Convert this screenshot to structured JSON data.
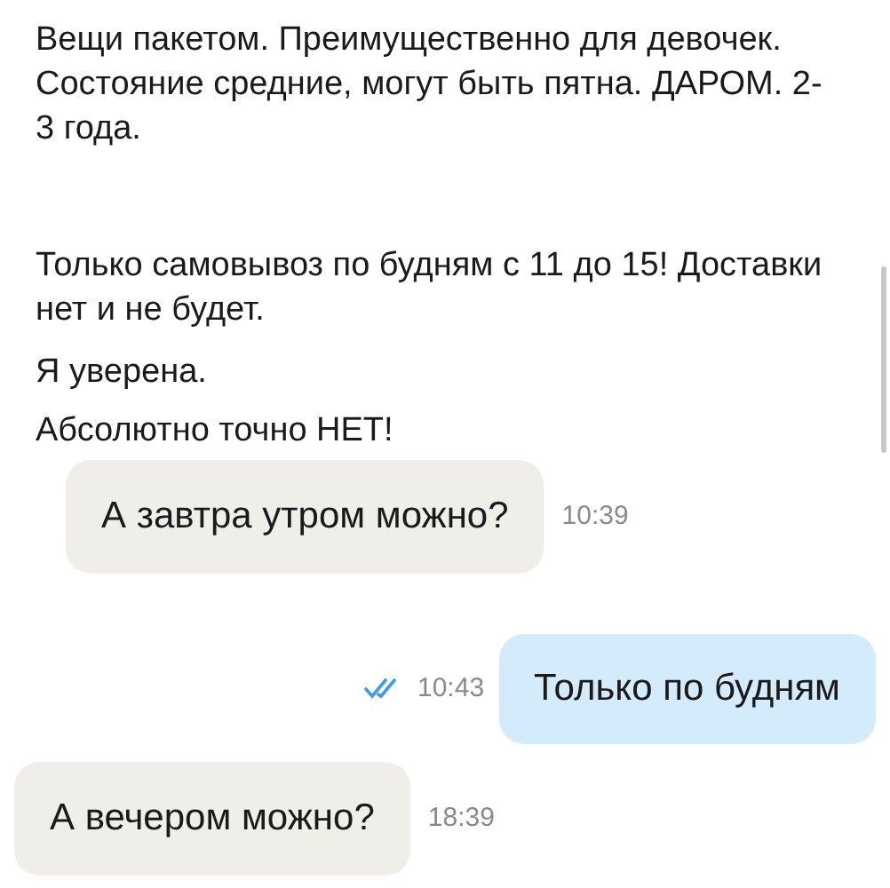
{
  "description": {
    "paragraphs": [
      "Вещи пакетом. Преимущественно для девочек. Состояние средние,  могут быть пятна. ДАРОМ. 2-3 года.",
      "Только самовывоз по будням с 11 до 15! Доставки нет и не будет.",
      "Я уверена.",
      "Абсолютно точно НЕТ!"
    ]
  },
  "messages": [
    {
      "kind": "incoming",
      "text": "А завтра утром можно?",
      "time": "10:39"
    },
    {
      "kind": "outgoing",
      "text": "Только по будням",
      "time": "10:43",
      "read": true
    },
    {
      "kind": "incoming",
      "text": "А вечером можно?",
      "time": "18:39"
    }
  ]
}
